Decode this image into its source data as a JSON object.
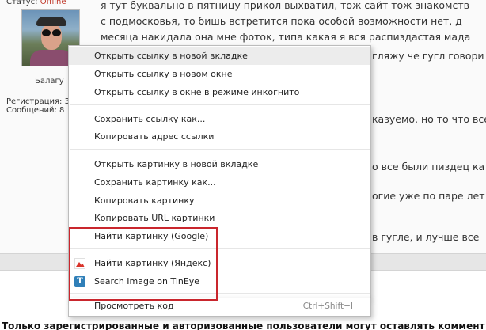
{
  "post": {
    "status_label": "Статус:",
    "status_value": "Offline",
    "username": "Балагу",
    "registration": "Регистрация: 3",
    "messages": "Сообщений: 8",
    "lines": [
      "я тут буквально в пятницу прикол выхватил, тож сайт тож знакомств",
      "с подмосковья, то бишь встретится пока особой возможности нет, д",
      "месяца накидала она мне фоток, типа какая я вся распиздастая мада"
    ],
    "fragments": {
      "line4": "гляжу че гугл говори",
      "line5": "казуемо, но то что все",
      "line6": "о все были пиздец ка",
      "line7": "огие уже по паре лет",
      "line8": "в гугле, и лучше все"
    },
    "footer_notice": "Только зарегистрированные и авторизованные пользователи могут оставлять коммент"
  },
  "context_menu": {
    "open_link_new_tab": "Открыть ссылку в новой вкладке",
    "open_link_new_window": "Открыть ссылку в новом окне",
    "open_link_incognito": "Открыть ссылку в окне в режиме инкогнито",
    "save_link_as": "Сохранить ссылку как...",
    "copy_link_address": "Копировать адрес ссылки",
    "open_image_new_tab": "Открыть картинку в новой вкладке",
    "save_image_as": "Сохранить картинку как...",
    "copy_image": "Копировать картинку",
    "copy_image_url": "Копировать URL картинки",
    "search_image_google": "Найти картинку (Google)",
    "search_image_yandex": "Найти картинку (Яндекс)",
    "search_image_tineye": "Search Image on TinEye",
    "view_source": "Просмотреть код",
    "view_source_shortcut": "Ctrl+Shift+I"
  },
  "colors": {
    "highlight": "#c9262d",
    "offline": "#c0392b",
    "tineye": "#2f7fb8",
    "yandex": "#d9342b"
  },
  "icons": {
    "yandex": "yandex-image-icon",
    "tineye": "tineye-icon"
  }
}
